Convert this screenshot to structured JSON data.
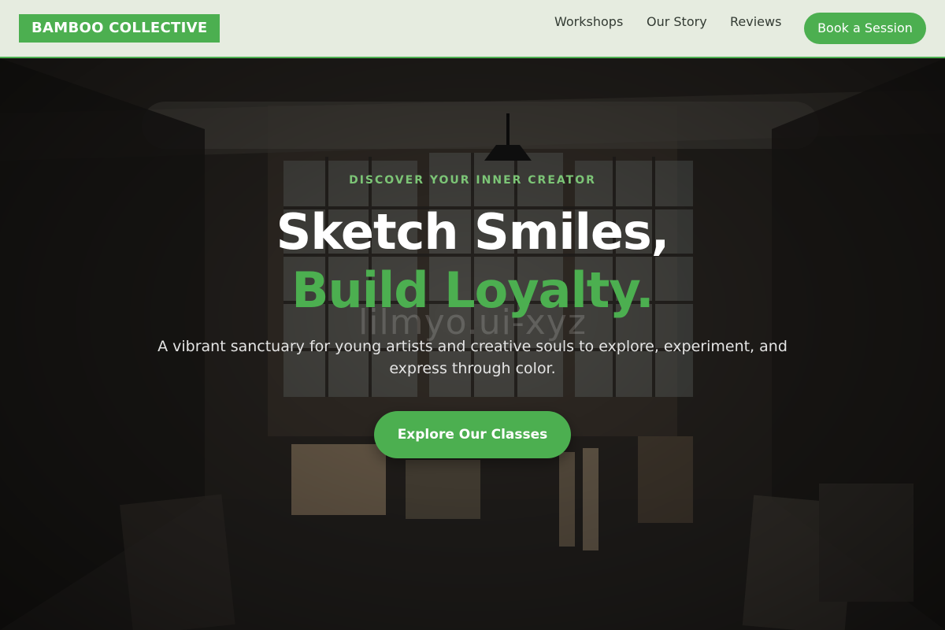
{
  "header": {
    "logo": "BAMBOO COLLECTIVE",
    "nav": [
      "Workshops",
      "Our Story",
      "Reviews"
    ],
    "cta_label": "Book a Session"
  },
  "hero": {
    "eyebrow": "DISCOVER YOUR INNER CREATOR",
    "headline_line1": "Sketch Smiles,",
    "headline_line2": "Build Loyalty.",
    "watermark": "lilmyo.ui-xyz",
    "subtitle": "A vibrant sanctuary for young artists and creative souls to explore, experiment, and express through color.",
    "cta_label": "Explore Our Classes"
  },
  "colors": {
    "accent": "#4caf50",
    "header_bg": "#e6ece0",
    "eyebrow": "#7cc576"
  }
}
